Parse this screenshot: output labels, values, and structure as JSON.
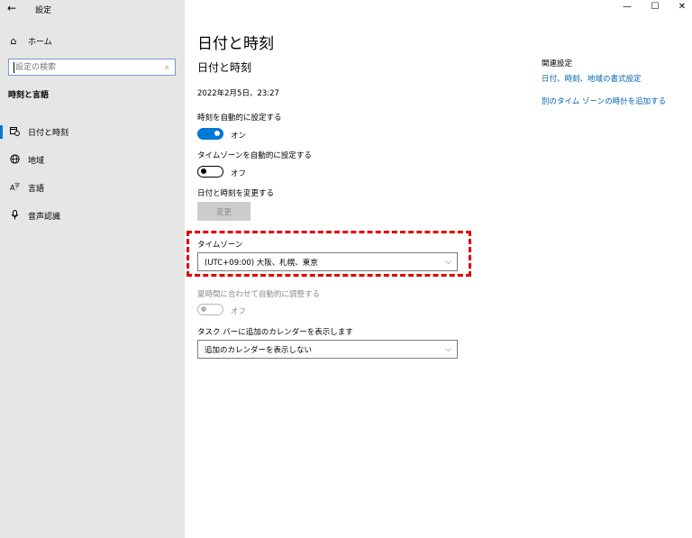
{
  "window": {
    "back_glyph": "←",
    "app_title": "設定",
    "minimize_glyph": "—",
    "maximize_glyph": "☐",
    "close_glyph": "✕"
  },
  "sidebar": {
    "home_label": "ホーム",
    "search_placeholder": "設定の検索",
    "section_heading": "時刻と言語",
    "items": [
      {
        "label": "日付と時刻",
        "icon": "calendar-clock-icon",
        "active": true
      },
      {
        "label": "地域",
        "icon": "globe-icon",
        "active": false
      },
      {
        "label": "言語",
        "icon": "language-icon",
        "active": false
      },
      {
        "label": "音声認識",
        "icon": "microphone-icon",
        "active": false
      }
    ]
  },
  "main": {
    "page_title": "日付と時刻",
    "sub_title": "日付と時刻",
    "current_datetime": "2022年2月5日、23:27",
    "auto_time": {
      "label": "時刻を自動的に設定する",
      "state": "オン"
    },
    "auto_timezone": {
      "label": "タイムゾーンを自動的に設定する",
      "state": "オフ"
    },
    "change_datetime": {
      "label": "日付と時刻を変更する",
      "button": "変更"
    },
    "timezone": {
      "label": "タイムゾーン",
      "value": "(UTC+09:00) 大阪、札幌、東京"
    },
    "dst": {
      "label": "夏時間に合わせて自動的に調整する",
      "state": "オフ"
    },
    "calendar": {
      "label": "タスク バーに追加のカレンダーを表示します",
      "value": "追加のカレンダーを表示しない"
    }
  },
  "related": {
    "heading": "関連設定",
    "links": [
      "日付、時刻、地域の書式設定",
      "別のタイム ゾーンの時計を追加する"
    ]
  },
  "colors": {
    "accent": "#0078d4",
    "highlight": "#e00000",
    "link": "#0063b1"
  }
}
